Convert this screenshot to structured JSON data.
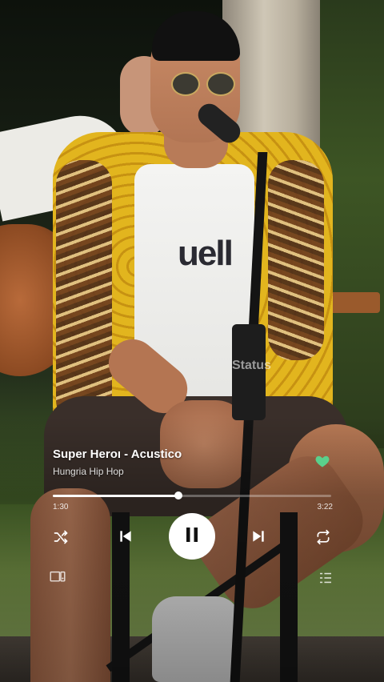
{
  "player": {
    "track_title": "Super Heroı - Acustico",
    "artist": "Hungria Hip Hop",
    "elapsed": "1:30",
    "total": "3:22",
    "progress": 0.45,
    "liked": true,
    "accent_color": "#5ad08c",
    "controls": {
      "shuffle_icon": "shuffle-icon",
      "previous_icon": "previous-icon",
      "play_state": "playing",
      "pause_icon": "pause-icon",
      "next_icon": "next-icon",
      "repeat_icon": "repeat-icon",
      "devices_icon": "connect-devices-icon",
      "queue_icon": "queue-icon"
    }
  },
  "video": {
    "watermark": "Status",
    "shirt_text": "uell"
  }
}
